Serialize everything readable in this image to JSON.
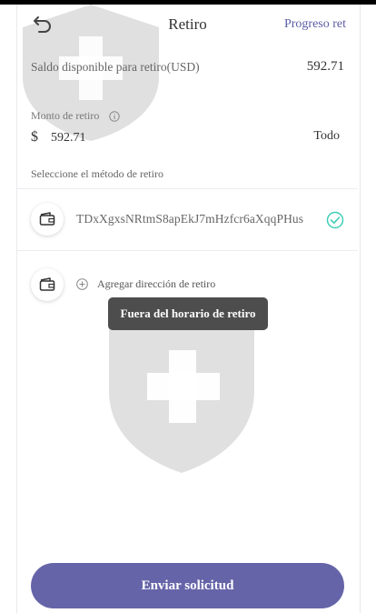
{
  "header": {
    "title": "Retiro",
    "progress_link": "Progreso ret",
    "back_icon": "undo-arrow-icon"
  },
  "balance": {
    "label": "Saldo disponible para retiro(USD)",
    "value": "592.71"
  },
  "amount": {
    "label": "Monto de retiro",
    "currency_symbol": "$",
    "value": "592.71",
    "all_label": "Todo"
  },
  "method": {
    "label": "Seleccione el método de retiro",
    "address": "TDxXgxsNRtmS8apEkJ7mHzfcr6aXqqPHus",
    "add_label": "Agregar dirección de retiro"
  },
  "toast": {
    "message": "Fuera del horario de retiro"
  },
  "submit": {
    "label": "Enviar solicitud"
  },
  "colors": {
    "accent": "#6664a8",
    "link": "#5b5ca6",
    "check": "#3fcfb8",
    "toast_bg": "#4d4d4d"
  }
}
